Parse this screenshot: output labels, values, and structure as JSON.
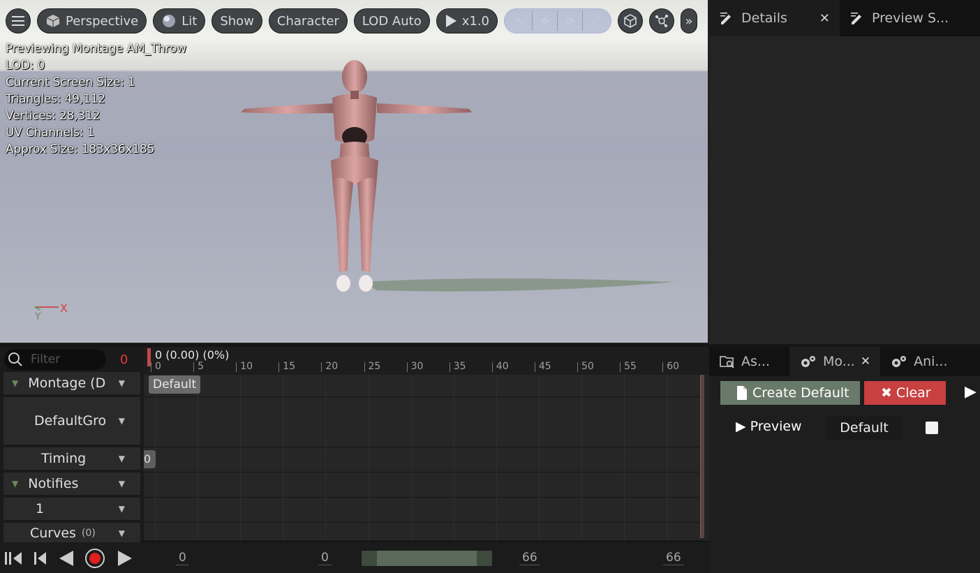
{
  "toolbar": {
    "perspective": "Perspective",
    "lit": "Lit",
    "show": "Show",
    "character": "Character",
    "lod": "LOD Auto",
    "speed": "x1.0"
  },
  "overlay": {
    "line1": "Previewing Montage AM_Throw",
    "line2": "LOD: 0",
    "line3": "Current Screen Size: 1",
    "line4": "Triangles: 49,112",
    "line5": "Vertices: 28,312",
    "line6": "UV Channels: 1",
    "line7": "Approx Size: 183x36x185"
  },
  "axes": {
    "x": "X",
    "y": "Y"
  },
  "details_tabs": {
    "details": "Details",
    "close": "✕",
    "preview": "Preview S..."
  },
  "tree": {
    "filter_placeholder": "Filter",
    "filter_count": "0",
    "montage": "Montage (D",
    "default_group": "DefaultGro",
    "timing": "Timing",
    "notifies": "Notifies",
    "notify_track": "1",
    "curves": "Curves",
    "curves_count": "(0)"
  },
  "timeline": {
    "position": "0 (0.00) (0%)",
    "ticks": [
      "0",
      "5",
      "10",
      "15",
      "20",
      "25",
      "30",
      "35",
      "40",
      "45",
      "50",
      "55",
      "60"
    ],
    "default_segment": "Default",
    "timing_segment": "0"
  },
  "transport": {
    "start_frame": "0",
    "current_frame": "0",
    "end_frame": "66",
    "total_frames": "66"
  },
  "montage_tabs": {
    "asset": "As...",
    "montage": "Mo...",
    "close": "✕",
    "anim": "Ani..."
  },
  "montage_panel": {
    "create_default": "Create Default",
    "clear": "Clear",
    "preview": "Preview",
    "default": "Default"
  }
}
